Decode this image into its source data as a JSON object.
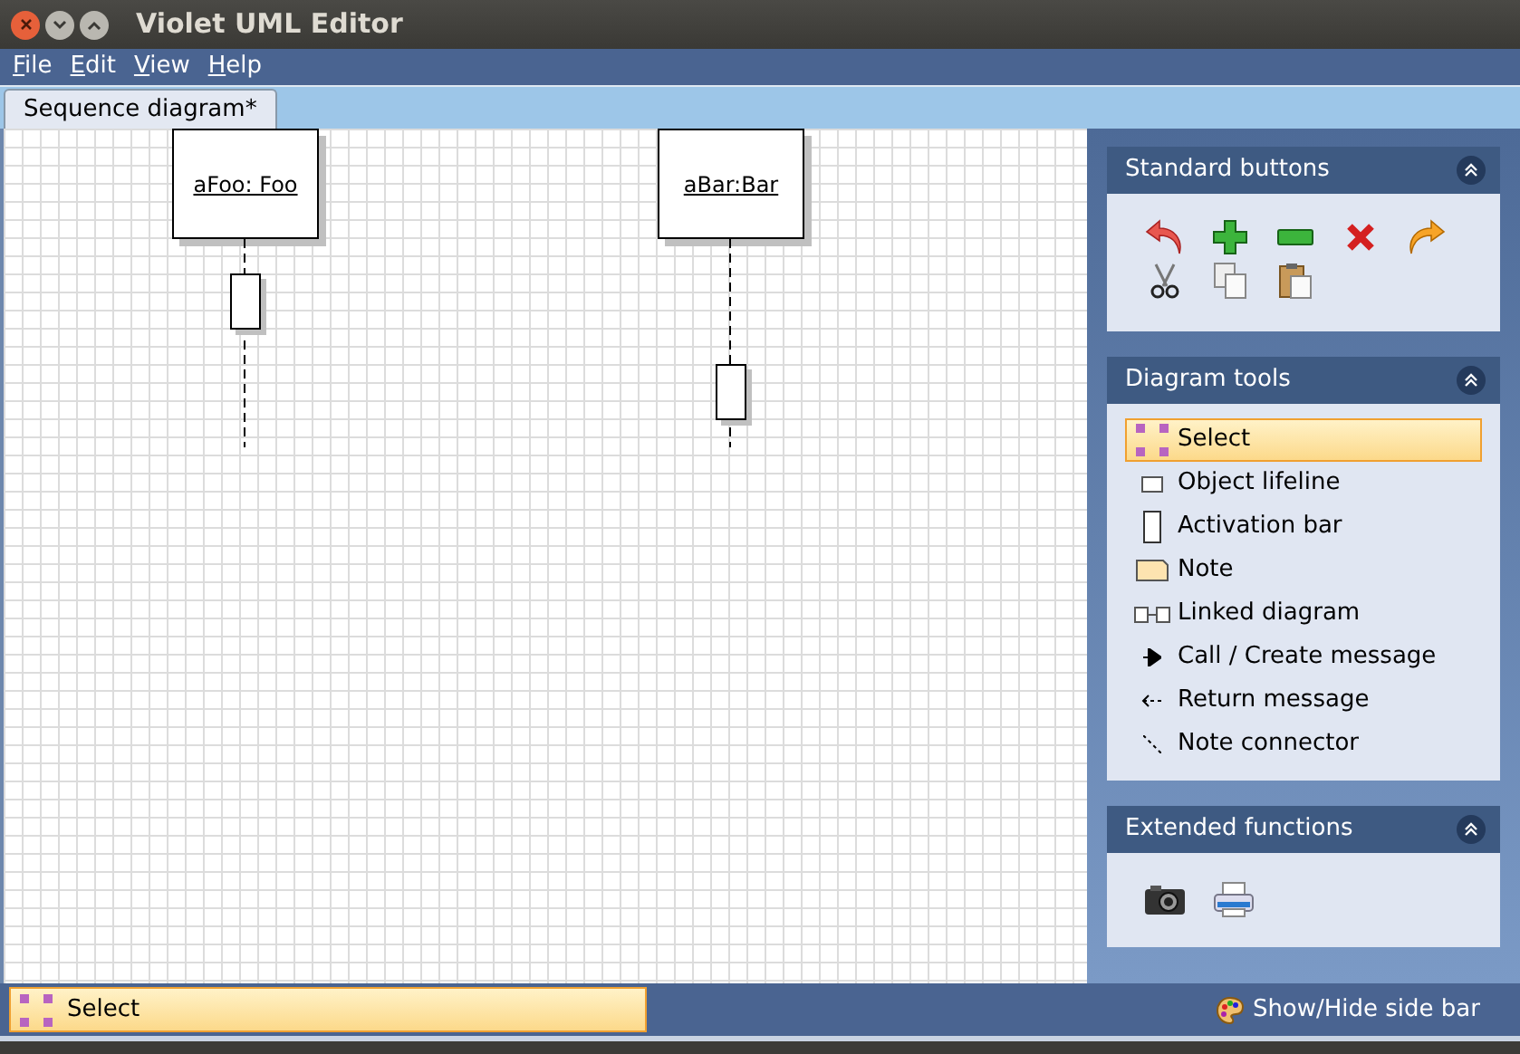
{
  "window": {
    "title": "Violet UML Editor"
  },
  "menu": [
    {
      "label": "File"
    },
    {
      "label": "Edit"
    },
    {
      "label": "View"
    },
    {
      "label": "Help"
    }
  ],
  "tabs": [
    {
      "label": "Sequence diagram*",
      "selected": true
    }
  ],
  "diagram": {
    "objects": [
      {
        "label": "aFoo: Foo"
      },
      {
        "label": "aBar:Bar"
      }
    ]
  },
  "sidebar": {
    "panels": [
      {
        "title": "Standard buttons",
        "kind": "buttons"
      },
      {
        "title": "Diagram tools",
        "kind": "tools"
      },
      {
        "title": "Extended functions",
        "kind": "extended"
      }
    ],
    "tools": [
      {
        "label": "Select",
        "kind": "select",
        "selected": true
      },
      {
        "label": "Object lifeline",
        "kind": "lifeline",
        "selected": false
      },
      {
        "label": "Activation bar",
        "kind": "activation",
        "selected": false
      },
      {
        "label": "Note",
        "kind": "note",
        "selected": false
      },
      {
        "label": "Linked diagram",
        "kind": "linked",
        "selected": false
      },
      {
        "label": "Call / Create message",
        "kind": "call",
        "selected": false
      },
      {
        "label": "Return message",
        "kind": "return",
        "selected": false
      },
      {
        "label": "Note connector",
        "kind": "connector",
        "selected": false
      }
    ]
  },
  "status_bar": {
    "current_tool": "Select",
    "toggle": "Show/Hide side bar"
  }
}
